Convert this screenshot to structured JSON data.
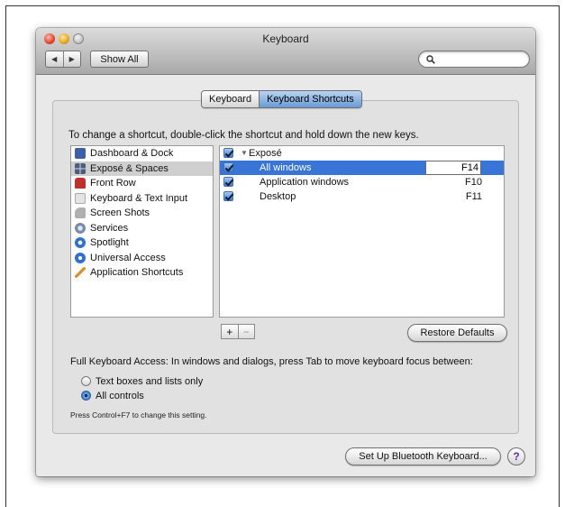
{
  "window": {
    "title": "Keyboard"
  },
  "toolbar": {
    "back_glyph": "◀",
    "forward_glyph": "▶",
    "show_all_label": "Show All",
    "search_value": ""
  },
  "tabs": [
    {
      "label": "Keyboard",
      "selected": false
    },
    {
      "label": "Keyboard Shortcuts",
      "selected": true
    }
  ],
  "instruction": "To change a shortcut, double-click the shortcut and hold down the new keys.",
  "categories": [
    {
      "label": "Dashboard & Dock",
      "icon": "dashboard-dock-icon",
      "color": "#3d5fa8"
    },
    {
      "label": "Exposé & Spaces",
      "icon": "expose-spaces-icon",
      "color": "#4b5d7a"
    },
    {
      "label": "Front Row",
      "icon": "front-row-icon",
      "color": "#c0302a"
    },
    {
      "label": "Keyboard & Text Input",
      "icon": "keyboard-text-input-icon",
      "color": "#bfbfbf"
    },
    {
      "label": "Screen Shots",
      "icon": "screen-shots-icon",
      "color": "#8a8a8a"
    },
    {
      "label": "Services",
      "icon": "services-icon",
      "color": "#7a8ba8"
    },
    {
      "label": "Spotlight",
      "icon": "spotlight-icon",
      "color": "#2f6fd0"
    },
    {
      "label": "Universal Access",
      "icon": "universal-access-icon",
      "color": "#2f6fd0"
    },
    {
      "label": "Application Shortcuts",
      "icon": "application-shortcuts-icon",
      "color": "#d8902a"
    }
  ],
  "shortcuts": {
    "group": {
      "label": "Exposé",
      "checked": true
    },
    "rows": [
      {
        "label": "All windows",
        "key": "F14",
        "checked": true
      },
      {
        "label": "Application windows",
        "key": "F10",
        "checked": true
      },
      {
        "label": "Desktop",
        "key": "F11",
        "checked": true
      }
    ]
  },
  "buttons": {
    "plus": "+",
    "minus": "−",
    "restore_defaults": "Restore Defaults",
    "bluetooth": "Set Up Bluetooth Keyboard...",
    "help": "?"
  },
  "full_keyboard_access": {
    "label": "Full Keyboard Access: In windows and dialogs, press Tab to move keyboard focus between:",
    "options": [
      {
        "label": "Text boxes and lists only",
        "selected": false
      },
      {
        "label": "All controls",
        "selected": true
      }
    ],
    "hint": "Press Control+F7 to change this setting."
  },
  "colors": {
    "selection_blue": "#3875d7"
  }
}
